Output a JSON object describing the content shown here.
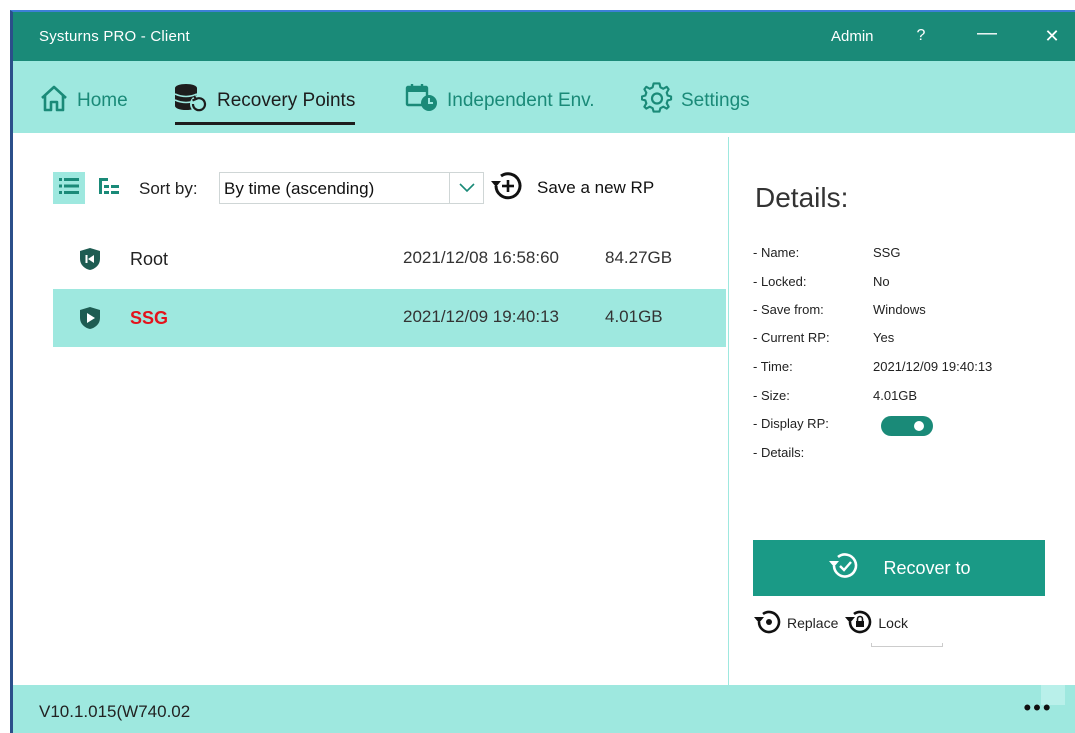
{
  "window": {
    "title": "Systurns PRO - Client",
    "user": "Admin",
    "help": "?",
    "minimize": "—",
    "close": "✕"
  },
  "tabs": [
    {
      "label": "Home",
      "icon": "home-icon",
      "active": false
    },
    {
      "label": "Recovery Points",
      "icon": "database-restore-icon",
      "active": true
    },
    {
      "label": "Independent Env.",
      "icon": "calendar-clock-icon",
      "active": false
    },
    {
      "label": "Settings",
      "icon": "gear-icon",
      "active": false
    }
  ],
  "toolbar": {
    "sort_label": "Sort by:",
    "sort_value": "By time (ascending)",
    "save_label": "Save a new RP"
  },
  "recovery_points": [
    {
      "name": "Root",
      "time": "2021/12/08 16:58:60",
      "size": "84.27GB",
      "selected": false,
      "icon": "shield-rewind-icon"
    },
    {
      "name": "SSG",
      "time": "2021/12/09 19:40:13",
      "size": "4.01GB",
      "selected": true,
      "icon": "shield-play-icon"
    }
  ],
  "details": {
    "title": "Details:",
    "rows": [
      {
        "key": "- Name:",
        "value": "SSG"
      },
      {
        "key": "- Locked:",
        "value": "No"
      },
      {
        "key": "- Save from:",
        "value": "Windows"
      },
      {
        "key": "- Current RP:",
        "value": "Yes"
      },
      {
        "key": "- Time:",
        "value": "2021/12/09 19:40:13"
      },
      {
        "key": "- Size:",
        "value": "4.01GB"
      },
      {
        "key": "- Display RP:",
        "value": ""
      },
      {
        "key": "- Details:",
        "value": ""
      }
    ],
    "display_rp_on": true
  },
  "actions": {
    "recover_label": "Recover to",
    "replace_label": "Replace",
    "lock_label": "Lock"
  },
  "footer": {
    "version": "V10.1.015(W740.02",
    "more": "•••"
  },
  "colors": {
    "titlebar": "#1a8a78",
    "accent_light": "#9ee8df",
    "accent": "#1a9a86",
    "selected_name": "#e3131c"
  }
}
